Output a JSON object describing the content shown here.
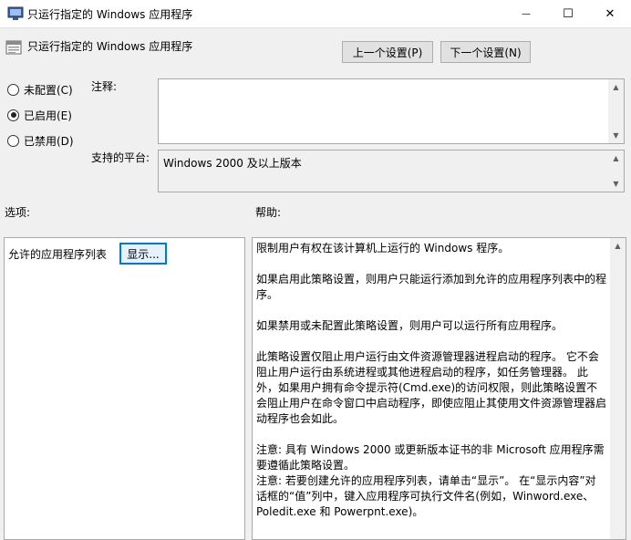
{
  "window": {
    "title": "只运行指定的 Windows 应用程序",
    "minimize_glyph": "—",
    "maximize_glyph": "☐",
    "close_glyph": "✕"
  },
  "header": {
    "policy_name": "只运行指定的 Windows 应用程序",
    "prev_label": "上一个设置(P)",
    "next_label": "下一个设置(N)"
  },
  "state": {
    "options": [
      {
        "label": "未配置(C)",
        "selected": false
      },
      {
        "label": "已启用(E)",
        "selected": true
      },
      {
        "label": "已禁用(D)",
        "selected": false
      }
    ]
  },
  "comment": {
    "label": "注释:",
    "value": ""
  },
  "platform": {
    "label": "支持的平台:",
    "value": "Windows 2000 及以上版本"
  },
  "options_section": {
    "label": "选项:",
    "allowed_list_label": "允许的应用程序列表",
    "show_button": "显示..."
  },
  "help_section": {
    "label": "帮助:",
    "lines": {
      "p1": "限制用户有权在该计算机上运行的 Windows 程序。",
      "p2": "如果启用此策略设置，则用户只能运行添加到允许的应用程序列表中的程序。",
      "p3": "如果禁用或未配置此策略设置，则用户可以运行所有应用程序。",
      "p4": "此策略设置仅阻止用户运行由文件资源管理器进程启动的程序。 它不会阻止用户运行由系统进程或其他进程启动的程序，如任务管理器。 此外，如果用户拥有命令提示符(Cmd.exe)的访问权限，则此策略设置不会阻止用户在命令窗口中启动程序，即使应阻止其使用文件资源管理器启动程序也会如此。",
      "p5": "注意: 具有 Windows 2000 或更新版本证书的非 Microsoft 应用程序需要遵循此策略设置。",
      "p6": "注意: 若要创建允许的应用程序列表，请单击“显示”。 在“显示内容”对话框的“值”列中，键入应用程序可执行文件名(例如，Winword.exe、Poledit.exe 和 Powerpnt.exe)。"
    }
  },
  "icons": {
    "app": "policy-editor-icon",
    "policy": "policy-setting-icon",
    "scroll_up": "▲",
    "scroll_down": "▼"
  }
}
